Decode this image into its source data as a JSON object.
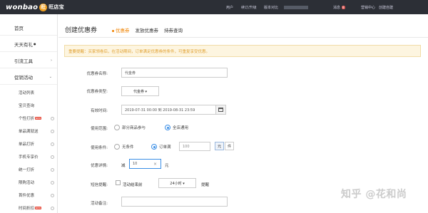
{
  "topbar": {
    "logo_text": "wonbao",
    "logo_badge": "旺",
    "logo_sub": "旺店宝",
    "nav": {
      "account": "用户",
      "renew": "续订/升级",
      "version": "版本对比",
      "messages": "消息",
      "messages_count": "8",
      "market": "营销中心",
      "create": "创建自建"
    }
  },
  "sidebar": {
    "items": [
      {
        "label": "首页"
      },
      {
        "label": "天天有礼",
        "badge": "●"
      },
      {
        "label": "引流工具",
        "arrow": "›"
      },
      {
        "label": "促销活动",
        "arrow": "⌄"
      }
    ],
    "sub_items": [
      {
        "label": "活动列表"
      },
      {
        "label": "宝贝查询"
      },
      {
        "label": "个性打折",
        "hot": "NEW"
      },
      {
        "label": "单品满就送"
      },
      {
        "label": "单品打折"
      },
      {
        "label": "手机专享价"
      },
      {
        "label": "统一打折"
      },
      {
        "label": "限购活动"
      },
      {
        "label": "首件优惠"
      },
      {
        "label": "时间折扣",
        "hot": "NEW"
      }
    ]
  },
  "main": {
    "title": "创建优惠券",
    "tabs": [
      {
        "label": "优惠券",
        "active": true
      },
      {
        "label": "发放优惠券"
      },
      {
        "label": "持券查询"
      }
    ],
    "notice": "重要提醒：买家领卷后，在活动期间，订单满足优惠券的条件，可重复享受优惠。"
  },
  "form": {
    "name": {
      "label": "优惠券名称:",
      "value": "代金券"
    },
    "type": {
      "label": "优惠券类型:",
      "value": "代金券 ▾"
    },
    "period": {
      "label": "有效时间:",
      "value": "2019-07-31 00:00 到 2019-08-31 23:59"
    },
    "scope": {
      "label": "使用范围:",
      "options": [
        {
          "label": "部分商品参与",
          "checked": false
        },
        {
          "label": "全店通用",
          "checked": true
        }
      ]
    },
    "condition": {
      "label": "使用条件:",
      "options": [
        {
          "label": "无条件",
          "checked": false
        },
        {
          "label": "订单满",
          "checked": true
        }
      ],
      "amount": "100",
      "units": [
        {
          "label": "元",
          "selected": true
        },
        {
          "label": "件",
          "selected": false
        }
      ]
    },
    "detail": {
      "label": "优惠详情:",
      "prefix": "减",
      "value": "10",
      "suffix": "元",
      "clear": "×"
    },
    "sms": {
      "label": "短信提醒:",
      "checkbox_label": "活动结束前",
      "select": "24小时 ▾",
      "suffix": "提醒"
    },
    "remark": {
      "label": "活动备注:",
      "value": ""
    }
  },
  "watermark": "知乎 @花和尚",
  "colors": {
    "accent": "#f08300",
    "radio": "#3a8ee6",
    "notice_bg": "#fdf5e0",
    "topbar": "#2c2f36"
  }
}
